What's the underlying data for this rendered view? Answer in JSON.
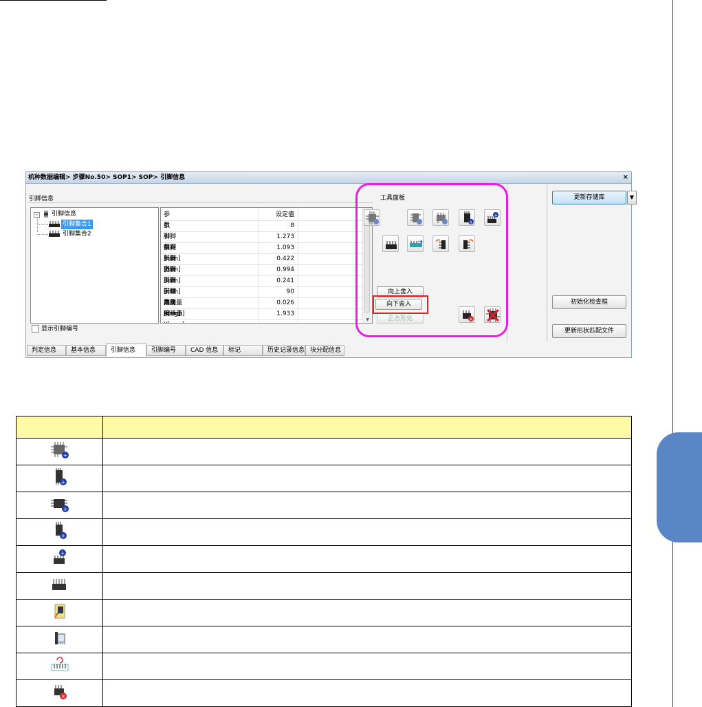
{
  "window": {
    "title": "机种数据编辑> 步骤No.50> SOP1> SOP> 引脚信息",
    "close_label": "×"
  },
  "pin_info": {
    "group_label": "引脚信息",
    "tree": {
      "root": "引脚信息",
      "children": [
        "引脚集合1",
        "引脚集合2"
      ],
      "selected_index": 0
    },
    "grid": {
      "headers": [
        "参数",
        "设定值"
      ],
      "rows": [
        [
          "引脚数",
          "8"
        ],
        [
          "引脚间距[mm]",
          "1.273"
        ],
        [
          "引脚长度[mm]",
          "1.093"
        ],
        [
          "引脚宽度[mm]",
          "0.422"
        ],
        [
          "引脚高度[mm]",
          "0.994"
        ],
        [
          "引脚前端高度[mm]",
          "0.241"
        ],
        [
          "引脚方向[deg]",
          "90"
        ],
        [
          "偏移量 X[mm]",
          "0.026"
        ],
        [
          "偏移量 Y[mm]",
          "1.933"
        ]
      ]
    },
    "show_pin_number_label": "显示引脚编号"
  },
  "tool_panel": {
    "label": "工具面板",
    "round_up_button": "向上舍入",
    "round_down_button": "向下舍入",
    "normalize_button": "正方形化"
  },
  "right_buttons": {
    "update_library": "更新存储库",
    "init_check_frame": "初始化检查框",
    "update_shape_match_file": "更新形状匹配文件"
  },
  "tabs": [
    {
      "label": "判定信息",
      "active": false
    },
    {
      "label": "基本信息",
      "active": false
    },
    {
      "label": "引脚信息",
      "active": true
    },
    {
      "label": "引脚编号",
      "active": false
    },
    {
      "label": "CAD 信息",
      "active": false
    },
    {
      "label": "标记",
      "active": false
    },
    {
      "label": "历史记录信息",
      "active": false
    },
    {
      "label": "块分配信息",
      "active": false
    }
  ],
  "icon_table": {
    "headers": [
      "",
      ""
    ],
    "rows": [
      {
        "icon": "qfp-add-icon",
        "description": ""
      },
      {
        "icon": "sop-vertical-add-icon",
        "description": ""
      },
      {
        "icon": "sop-horizontal-add-icon",
        "description": ""
      },
      {
        "icon": "dual-row-add-icon",
        "description": ""
      },
      {
        "icon": "single-row-add-icon",
        "description": ""
      },
      {
        "icon": "single-row-icon",
        "description": ""
      },
      {
        "icon": "flip-pin-icon",
        "description": ""
      },
      {
        "icon": "pin-offset-icon",
        "description": ""
      },
      {
        "icon": "rotate-pin-row-icon",
        "description": ""
      },
      {
        "icon": "delete-pin-row-icon",
        "description": ""
      }
    ]
  },
  "colors": {
    "highlight_magenta": "#e81ee8",
    "highlight_red": "#e0232a",
    "table_header_bg": "#fffaa5",
    "side_tab": "#5b86c6",
    "selection": "#3399ff"
  }
}
